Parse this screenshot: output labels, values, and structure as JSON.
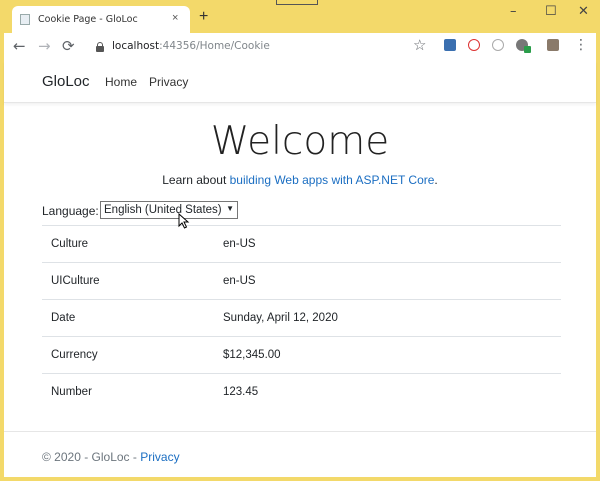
{
  "browser": {
    "tab_title": "Cookie Page - GloLoc",
    "tab_close": "×",
    "new_tab": "+",
    "window_controls": {
      "minimize": "–",
      "maximize": "☐",
      "close": "✕"
    },
    "nav": {
      "back": "←",
      "forward": "→",
      "reload": "⟳"
    },
    "url_host": "localhost",
    "url_rest": ":44356/Home/Cookie",
    "star": "☆",
    "menu": "⋮",
    "extension_icons": [
      "extension-icon-1",
      "extension-icon-2",
      "extension-icon-3",
      "extension-icon-4",
      "extension-icon-5",
      "profile-icon"
    ]
  },
  "site": {
    "brand": "GloLoc",
    "nav": {
      "home": "Home",
      "privacy": "Privacy"
    }
  },
  "main": {
    "heading": "Welcome",
    "learn_prefix": "Learn about ",
    "learn_link": "building Web apps with ASP.NET Core",
    "learn_suffix": ".",
    "language_label": "Language:",
    "language_selected": "English (United States)",
    "rows": [
      {
        "key": "Culture",
        "value": "en-US"
      },
      {
        "key": "UICulture",
        "value": "en-US"
      },
      {
        "key": "Date",
        "value": "Sunday, April 12, 2020"
      },
      {
        "key": "Currency",
        "value": "$12,345.00"
      },
      {
        "key": "Number",
        "value": "123.45"
      }
    ]
  },
  "footer": {
    "text": "© 2020 - GloLoc - ",
    "privacy": "Privacy"
  },
  "colors": {
    "link": "#1b6ec2",
    "window_frame": "#f3d96a"
  }
}
